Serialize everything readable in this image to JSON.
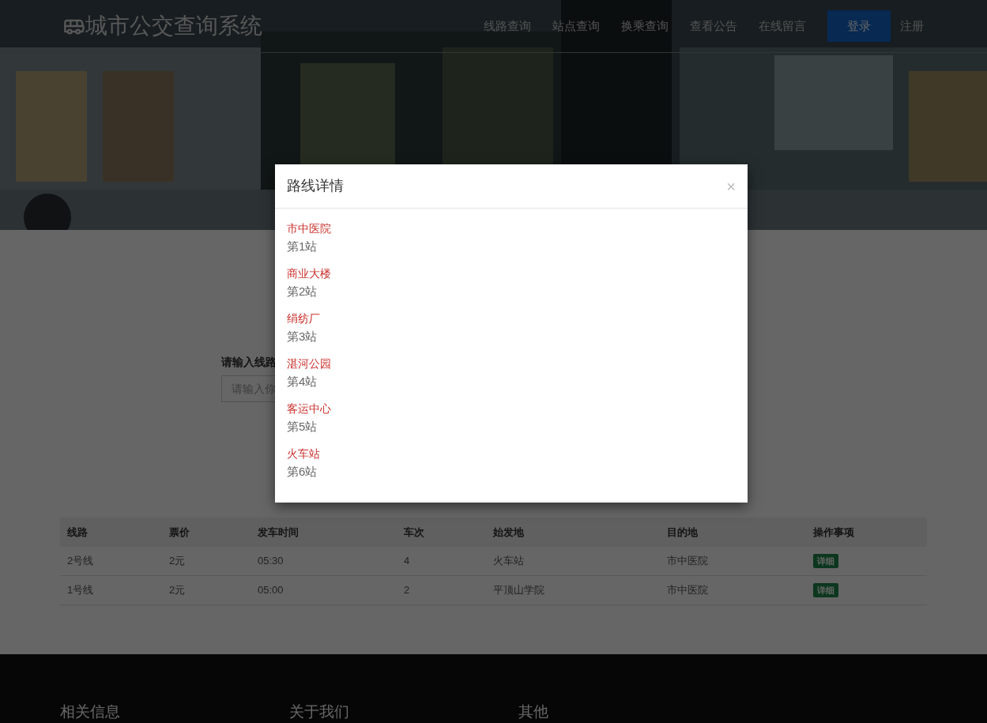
{
  "navbar": {
    "brand": "城市公交查询系统",
    "links": [
      {
        "label": "线路查询"
      },
      {
        "label": "站点查询"
      },
      {
        "label": "换乘查询"
      },
      {
        "label": "查看公告"
      },
      {
        "label": "在线留言"
      }
    ],
    "login_button": "登录",
    "register_link": "注册"
  },
  "search": {
    "label": "请输入线路",
    "placeholder": "请输入你"
  },
  "table": {
    "columns": [
      "线路",
      "票价",
      "发车时间",
      "车次",
      "始发地",
      "目的地",
      "操作事项"
    ],
    "rows": [
      {
        "cells": [
          "2号线",
          "2元",
          "05:30",
          "4",
          "火车站",
          "市中医院"
        ],
        "action": "详细"
      },
      {
        "cells": [
          "1号线",
          "2元",
          "05:00",
          "2",
          "平顶山学院",
          "市中医院"
        ],
        "action": "详细"
      }
    ]
  },
  "footer": {
    "headings": [
      "相关信息",
      "关于我们",
      "其他"
    ]
  },
  "modal": {
    "title": "路线详情",
    "close": "×",
    "stops": [
      {
        "name": "市中医院",
        "order": "第1站"
      },
      {
        "name": "商业大楼",
        "order": "第2站"
      },
      {
        "name": "绢纺厂",
        "order": "第3站"
      },
      {
        "name": "湛河公园",
        "order": "第4站"
      },
      {
        "name": "客运中心",
        "order": "第5站"
      },
      {
        "name": "火车站",
        "order": "第6站"
      }
    ]
  }
}
